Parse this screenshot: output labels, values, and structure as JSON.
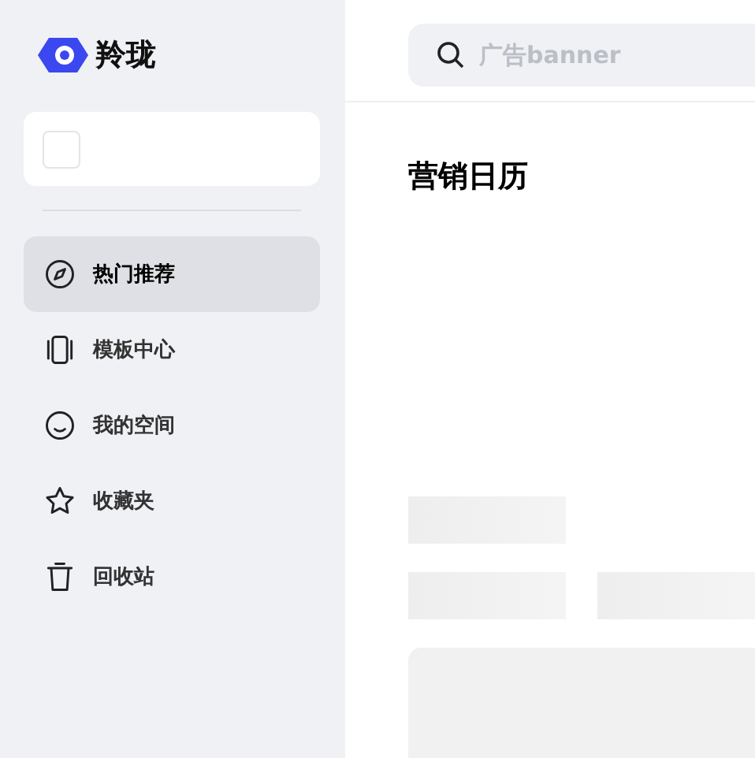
{
  "logo": {
    "name": "羚珑"
  },
  "nav": [
    {
      "label": "热门推荐",
      "selected": true
    },
    {
      "label": "模板中心",
      "selected": false
    },
    {
      "label": "我的空间",
      "selected": false
    },
    {
      "label": "收藏夹",
      "selected": false
    },
    {
      "label": "回收站",
      "selected": false
    }
  ],
  "search": {
    "placeholder": "广告banner"
  },
  "section": {
    "title": "营销日历"
  }
}
